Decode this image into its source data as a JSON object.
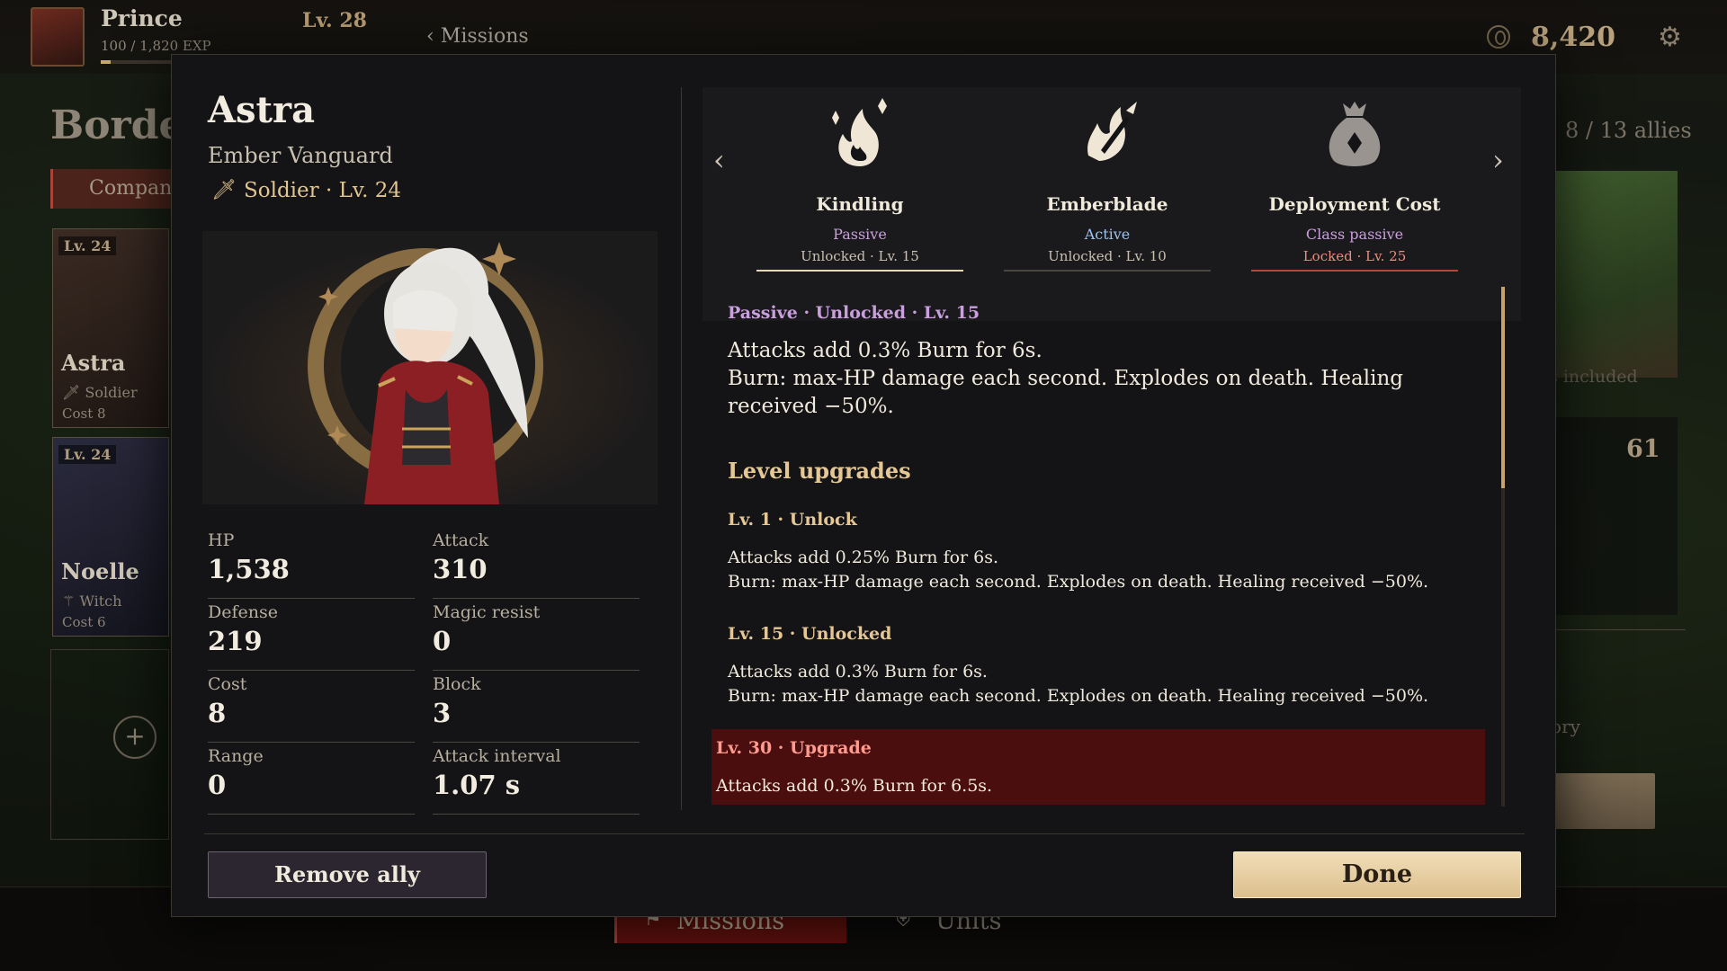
{
  "topbar": {
    "player_name": "Prince",
    "exp_text": "100 / 1,820 EXP",
    "exp_progress": 0.055,
    "level": "Lv. 28",
    "back_label": "‹  Missions",
    "gold": "8,420"
  },
  "background": {
    "panel_title": "Border",
    "tab_label": "Compan",
    "allies_count": "8 / 13 allies",
    "included_text": "ays included",
    "number": "61",
    "story_text": "tory",
    "cards": [
      {
        "level": "Lv. 24",
        "name": "Astra",
        "class": "Soldier",
        "cost": "Cost 8"
      },
      {
        "level": "Lv. 24",
        "name": "Noelle",
        "class": "Witch",
        "cost": "Cost 6"
      }
    ],
    "add_symbol": "+"
  },
  "bottom_nav": {
    "missions_label": "Missions",
    "units_label": "Units"
  },
  "unit": {
    "name": "Astra",
    "title": "Ember Vanguard",
    "class_line": "Soldier · Lv. 24",
    "stats": [
      {
        "label": "HP",
        "value": "1,538"
      },
      {
        "label": "Attack",
        "value": "310"
      },
      {
        "label": "Defense",
        "value": "219"
      },
      {
        "label": "Magic resist",
        "value": "0"
      },
      {
        "label": "Cost",
        "value": "8"
      },
      {
        "label": "Block",
        "value": "3"
      },
      {
        "label": "Range",
        "value": "0"
      },
      {
        "label": "Attack interval",
        "value": "1.07 s"
      }
    ]
  },
  "skills": {
    "prev_arrow": "‹",
    "next_arrow": "›",
    "items": [
      {
        "name": "Kindling",
        "type": "Passive",
        "status": "Unlocked · Lv. 15",
        "icon": "flame-sparks-icon",
        "type_color": "#c9a0dd"
      },
      {
        "name": "Emberblade",
        "type": "Active",
        "status": "Unlocked · Lv. 10",
        "icon": "flaming-blade-icon",
        "type_color": "#9ec3ee"
      },
      {
        "name": "Deployment Cost",
        "type": "Class passive",
        "status": "Locked · Lv. 25",
        "icon": "money-bag-icon",
        "type_color": "#c9a0dd",
        "status_color": "#f08a7f"
      }
    ]
  },
  "detail": {
    "header": "Passive · Unlocked · Lv. 15",
    "desc_line1": "Attacks add 0.3% Burn for 6s.",
    "desc_line2": "Burn: max-HP damage each second. Explodes on death. Healing received −50%.",
    "upgrades_title": "Level upgrades",
    "levels": [
      {
        "header": "Lv. 1 · Unlock",
        "line1": "Attacks add 0.25% Burn for 6s.",
        "line2": "Burn: max-HP damage each second. Explodes on death. Healing received −50%."
      },
      {
        "header": "Lv. 15 · Unlocked",
        "line1": "Attacks add 0.3% Burn for 6s.",
        "line2": "Burn: max-HP damage each second. Explodes on death. Healing received −50%."
      },
      {
        "header": "Lv. 30 · Upgrade",
        "line1": "Attacks add 0.3% Burn for 6.5s."
      }
    ]
  },
  "footer": {
    "remove_label": "Remove ally",
    "done_label": "Done"
  },
  "colors": {
    "gold_accent": "#e4c795",
    "passive": "#c9a0dd",
    "active": "#9ec3ee",
    "locked": "#f08a7f",
    "upgrade_bg": "#4a0e0e"
  }
}
